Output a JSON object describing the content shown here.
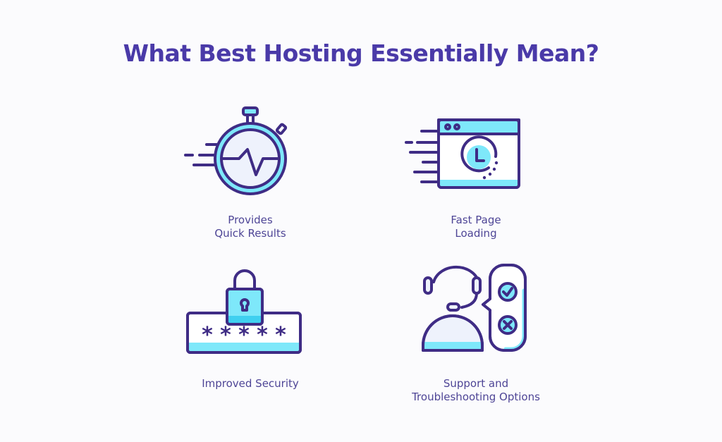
{
  "title": "What Best Hosting Essentially Mean?",
  "colors": {
    "stroke": "#3f2c85",
    "accent_cyan": "#7ee8fa",
    "light_fill": "#eef2fc",
    "title": "#4a3aa8",
    "label": "#4e4596"
  },
  "features": [
    {
      "icon": "stopwatch-icon",
      "label_lines": [
        "Provides",
        "Quick Results"
      ]
    },
    {
      "icon": "browser-clock-icon",
      "label_lines": [
        "Fast Page",
        "Loading"
      ]
    },
    {
      "icon": "padlock-password-icon",
      "label_lines": [
        "Improved Security"
      ]
    },
    {
      "icon": "headset-support-icon",
      "label_lines": [
        "Support and",
        "Troubleshooting Options"
      ]
    }
  ]
}
